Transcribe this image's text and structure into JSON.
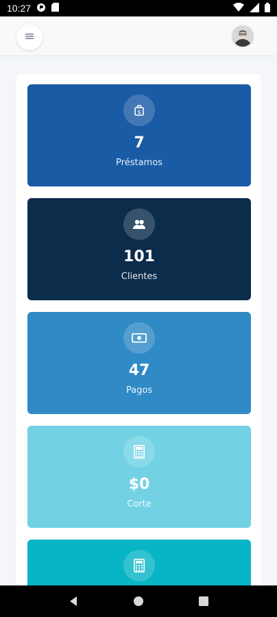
{
  "status_bar": {
    "time": "10:27",
    "icons_left": [
      "notification-icon",
      "sd-card-icon"
    ],
    "icons_right": [
      "wifi-icon",
      "signal-icon",
      "battery-icon"
    ]
  },
  "header": {
    "menu_icon": "menu-icon",
    "avatar": "user-avatar"
  },
  "cards": [
    {
      "value": "7",
      "label": "Préstamos",
      "icon": "loan-icon",
      "color": "#1a5ba5"
    },
    {
      "value": "101",
      "label": "Clientes",
      "icon": "users-icon",
      "color": "#0c2c4c"
    },
    {
      "value": "47",
      "label": "Pagos",
      "icon": "money-icon",
      "color": "#2f8ac6"
    },
    {
      "value": "$0",
      "label": "Corte",
      "icon": "calculator-icon",
      "color": "#72d2e4"
    },
    {
      "value": "",
      "label": "",
      "icon": "calculator-icon",
      "color": "#08b5c6"
    }
  ],
  "nav_bar": {
    "buttons": [
      "back-button",
      "home-button",
      "recents-button"
    ]
  }
}
